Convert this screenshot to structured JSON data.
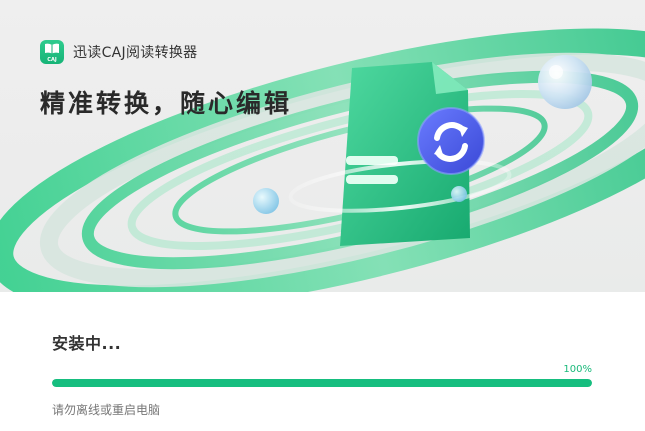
{
  "app": {
    "logo_text": "CAJ",
    "name": "迅读CAJ阅读转换器"
  },
  "hero": {
    "slogan": "精准转换，随心编辑",
    "illustration_icon": "convert-refresh-icon"
  },
  "install": {
    "status_title": "安装中...",
    "progress_value": 1.0,
    "progress_label": "100%",
    "hint": "请勿离线或重启电脑"
  },
  "colors": {
    "accent": "#16be7f",
    "accent_text": "#19b97a",
    "icon_badge": "#4b5ee8",
    "title_text": "#2a2a2a"
  }
}
